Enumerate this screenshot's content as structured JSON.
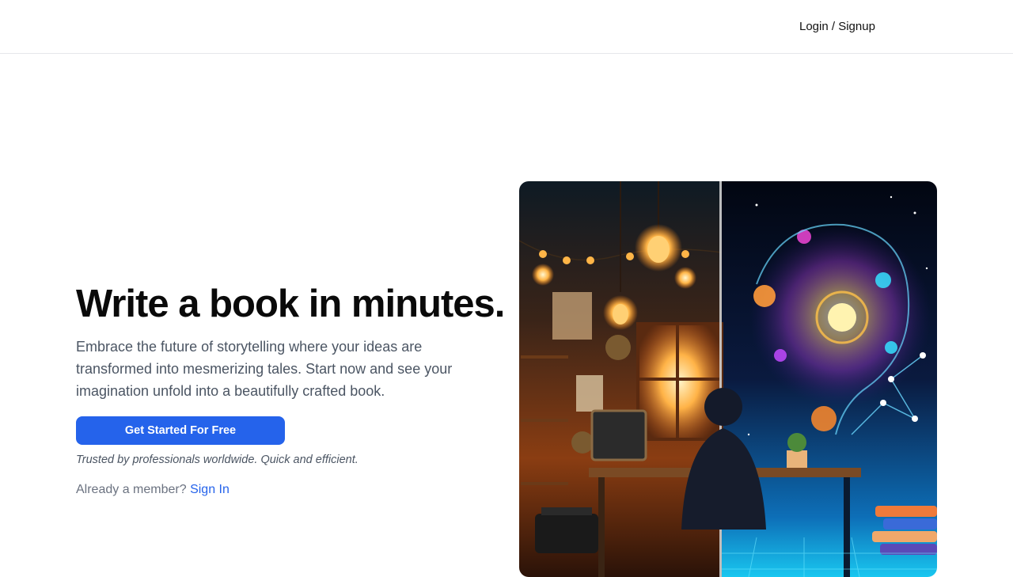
{
  "header": {
    "login_label": "Login / Signup"
  },
  "hero": {
    "headline": "Write a book in minutes.",
    "subtitle": "Embrace the future of storytelling where your ideas are transformed into mesmerizing tales. Start now and see your imagination unfold into a beautifully crafted book.",
    "cta_label": "Get Started For Free",
    "trusted_text": "Trusted by professionals worldwide. Quick and efficient.",
    "member_prompt": "Already a member?",
    "signin_label": "Sign In"
  },
  "colors": {
    "accent": "#2563eb",
    "text_dark": "#0a0a0a",
    "text_muted": "#4b5563"
  }
}
